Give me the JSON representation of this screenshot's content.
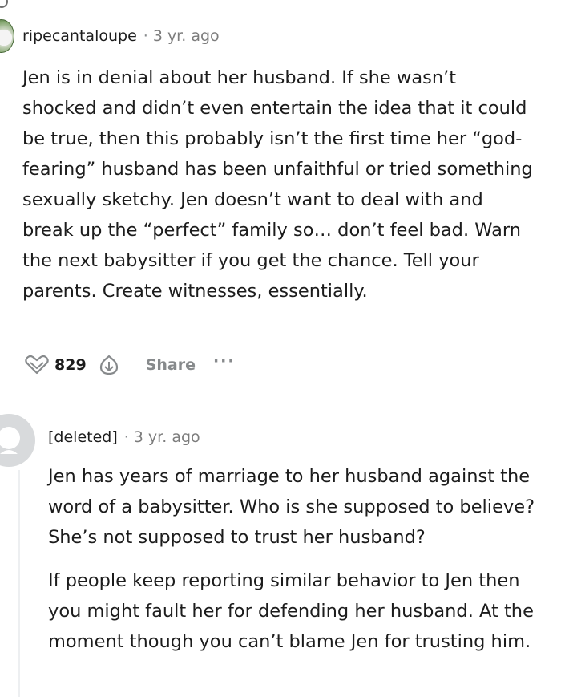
{
  "comments": [
    {
      "author": "ripecantaloupe",
      "time": "3 yr. ago",
      "paragraphs": [
        "Jen is in denial about her husband. If she wasn’t shocked and didn’t even entertain the idea that it could be true, then this probably isn’t the first time her “god-fearing” husband has been unfaithful or tried something sexually sketchy. Jen doesn’t want to deal with and break up the “perfect” family so… don’t feel bad. Warn the next babysitter if you get the chance. Tell your parents. Create witnesses, essentially."
      ],
      "score": "829",
      "share_label": "Share",
      "more_label": "···"
    },
    {
      "author": "[deleted]",
      "time": "3 yr. ago",
      "paragraphs": [
        "Jen has years of marriage to her husband against the word of a babysitter. Who is she supposed to believe? She’s not supposed to trust her husband?",
        "If people keep reporting similar behavior to Jen then you might fault her for defending her husband. At the moment though you can’t blame Jen for trusting him."
      ]
    }
  ],
  "separator": "·",
  "icons": {
    "upvote": "upvote-icon",
    "downvote": "downvote-icon",
    "more": "more-options-icon",
    "avatar_deleted": "default-avatar-icon"
  },
  "colors": {
    "text": "#1c1c1c",
    "muted": "#878a8c",
    "thread": "#edeff1"
  }
}
